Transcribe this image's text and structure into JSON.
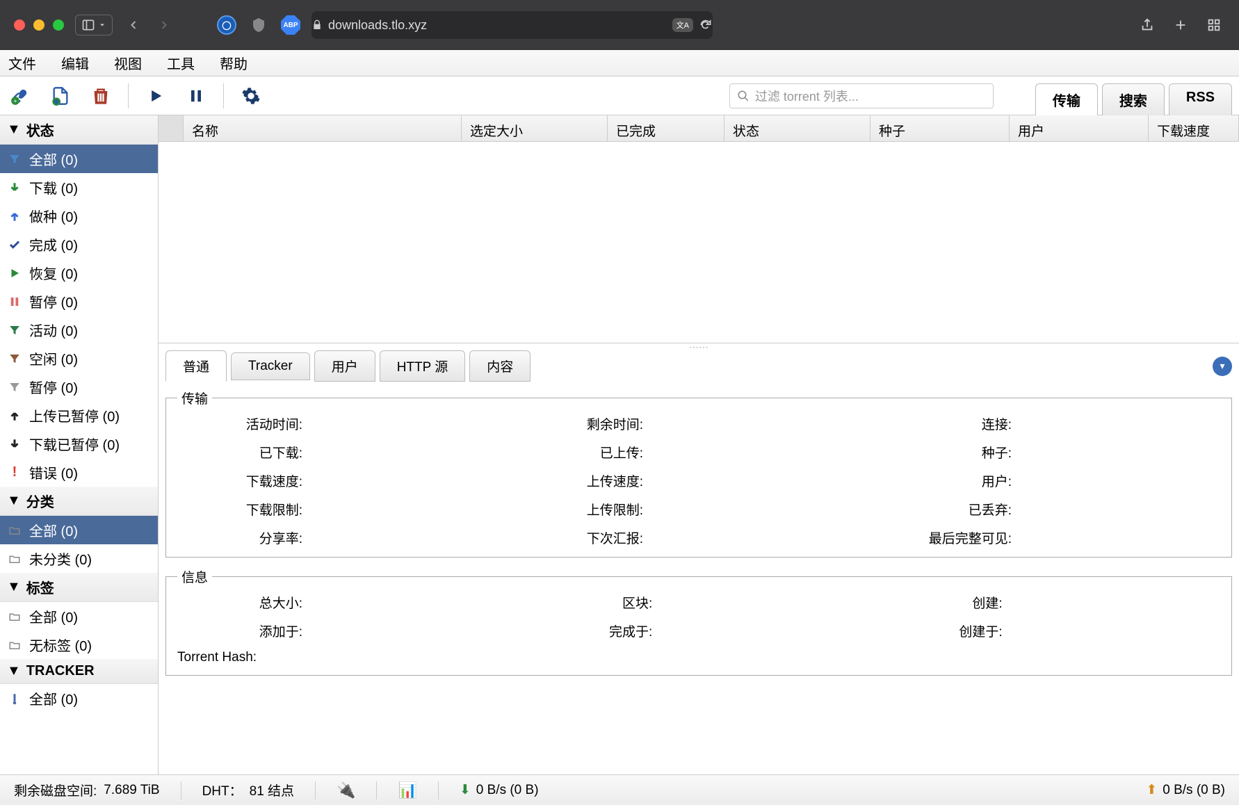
{
  "browser": {
    "url": "downloads.tlo.xyz"
  },
  "menubar": {
    "items": [
      "文件",
      "编辑",
      "视图",
      "工具",
      "帮助"
    ]
  },
  "toolbar": {
    "search_placeholder": "过滤 torrent 列表...",
    "tabs": [
      "传输",
      "搜索",
      "RSS"
    ]
  },
  "sidebar": {
    "status_header": "状态",
    "status_items": [
      {
        "label": "全部 (0)",
        "selected": true,
        "icon": "filter-blue"
      },
      {
        "label": "下载 (0)",
        "icon": "arrow-down-green"
      },
      {
        "label": "做种 (0)",
        "icon": "arrow-up-blue"
      },
      {
        "label": "完成 (0)",
        "icon": "check-blue"
      },
      {
        "label": "恢复 (0)",
        "icon": "play-green"
      },
      {
        "label": "暂停 (0)",
        "icon": "pause-red"
      },
      {
        "label": "活动 (0)",
        "icon": "filter-green"
      },
      {
        "label": "空闲 (0)",
        "icon": "filter-brown"
      },
      {
        "label": "暂停 (0)",
        "icon": "filter-grey"
      },
      {
        "label": "上传已暂停 (0)",
        "icon": "arrow-up-black"
      },
      {
        "label": "下载已暂停 (0)",
        "icon": "arrow-down-black"
      },
      {
        "label": "错误 (0)",
        "icon": "exclaim-red"
      }
    ],
    "category_header": "分类",
    "category_items": [
      {
        "label": "全部 (0)",
        "selected": true,
        "icon": "folder"
      },
      {
        "label": "未分类 (0)",
        "icon": "folder"
      }
    ],
    "tags_header": "标签",
    "tags_items": [
      {
        "label": "全部 (0)",
        "icon": "folder"
      },
      {
        "label": "无标签 (0)",
        "icon": "folder"
      }
    ],
    "tracker_header": "TRACKER",
    "tracker_items": [
      {
        "label": "全部 (0)",
        "icon": "tracker"
      }
    ]
  },
  "table": {
    "columns": [
      "名称",
      "选定大小",
      "已完成",
      "状态",
      "种子",
      "用户",
      "下载速度"
    ],
    "widths": [
      400,
      210,
      168,
      210,
      200,
      200,
      130
    ]
  },
  "detail_tabs": [
    "普通",
    "Tracker",
    "用户",
    "HTTP 源",
    "内容"
  ],
  "detail": {
    "transfer_legend": "传输",
    "transfer_rows": [
      [
        "活动时间:",
        "剩余时间:",
        "连接:"
      ],
      [
        "已下载:",
        "已上传:",
        "种子:"
      ],
      [
        "下载速度:",
        "上传速度:",
        "用户:"
      ],
      [
        "下载限制:",
        "上传限制:",
        "已丢弃:"
      ],
      [
        "分享率:",
        "下次汇报:",
        "最后完整可见:"
      ]
    ],
    "info_legend": "信息",
    "info_rows": [
      [
        "总大小:",
        "区块:",
        "创建:"
      ],
      [
        "添加于:",
        "完成于:",
        "创建于:"
      ]
    ],
    "torrent_hash_label": "Torrent Hash:"
  },
  "statusbar": {
    "disk_label": "剩余磁盘空间:",
    "disk_value": "7.689 TiB",
    "dht_label": "DHT：",
    "dht_value": "81 结点",
    "down": "0 B/s (0 B)",
    "up": "0 B/s (0 B)"
  }
}
